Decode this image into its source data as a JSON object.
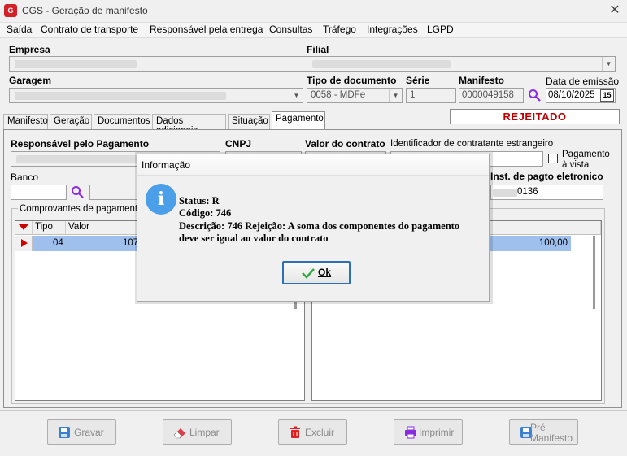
{
  "window": {
    "title": "CGS - Geração de manifesto",
    "close_glyph": "✕",
    "app_icon_text": "G"
  },
  "menu": {
    "items": [
      "Saída",
      "Contrato de transporte",
      "Responsável pela entrega",
      "Consultas",
      "Tráfego",
      "Integrações",
      "LGPD"
    ]
  },
  "header": {
    "empresa_label": "Empresa",
    "filial_label": "Filial",
    "garagem_label": "Garagem",
    "tipo_doc_label": "Tipo de documento",
    "tipo_doc_value": "0058 - MDFe",
    "serie_label": "Série",
    "serie_value": "1",
    "manifesto_label": "Manifesto",
    "manifesto_value": "0000049158",
    "data_emissao_label": "Data de emissão",
    "data_emissao_value": "08/10/2025",
    "calendar_text": "15"
  },
  "tabs": [
    "Manifesto",
    "Geração",
    "Documentos",
    "Dados adicionais",
    "Situação",
    "Pagamento"
  ],
  "active_tab": "Pagamento",
  "status_value": "REJEITADO",
  "pagamento": {
    "responsavel_label": "Responsável pelo Pagamento",
    "cnpj_label": "CNPJ",
    "valor_contrato_label": "Valor do contrato",
    "identificador_label": "Identificador de contratante estrangeiro",
    "pagamento_vista_label_1": "Pagamento",
    "pagamento_vista_label_2": "à vista",
    "banco_label": "Banco",
    "inst_pagto_label": "Inst. de pagto eletronico",
    "inst_pagto_value": "0136",
    "comprovantes_label": "Comprovantes de pagamento d",
    "grid_left": {
      "headers": [
        "Tipo",
        "Valor"
      ],
      "rows": [
        {
          "tipo": "04",
          "valor": "107"
        }
      ]
    },
    "grid_right": {
      "header_fragment": "r",
      "rows": [
        {
          "valor": "100,00"
        }
      ]
    }
  },
  "buttons": {
    "gravar": "Gravar",
    "limpar": "Limpar",
    "excluir": "Excluir",
    "imprimir": "Imprimir",
    "pre_1": "Pré",
    "pre_2": "Manifesto"
  },
  "dialog": {
    "title": "Informação",
    "icon_text": "i",
    "status_line": "Status: R",
    "codigo_line": "Código: 746",
    "descricao_line_1": "Descrição: 746 Rejeição: A soma dos componentes do pagamento",
    "descricao_line_2": "deve ser igual ao valor do contrato",
    "ok_label": "Ok"
  },
  "colors": {
    "status_red": "#c00000",
    "selected_row": "#9fc0ec",
    "accent_purple": "#8a2be2"
  }
}
